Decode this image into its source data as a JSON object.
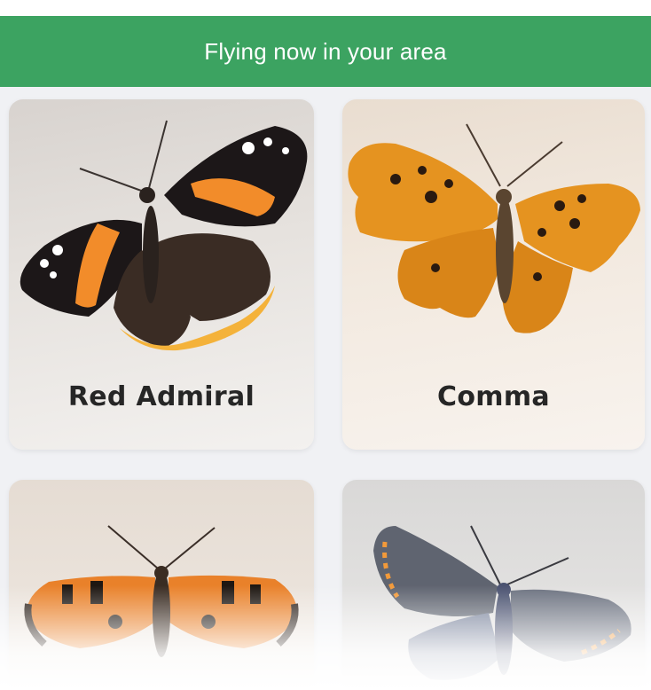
{
  "header": {
    "banner_text": "Flying now in your area",
    "banner_color": "#3ca361"
  },
  "species": [
    {
      "name": "Red Admiral",
      "image": "red-admiral-butterfly-photo"
    },
    {
      "name": "Comma",
      "image": "comma-butterfly-photo"
    },
    {
      "name": "",
      "image": "small-tortoiseshell-butterfly-photo"
    },
    {
      "name": "",
      "image": "small-blue-butterfly-photo"
    }
  ]
}
